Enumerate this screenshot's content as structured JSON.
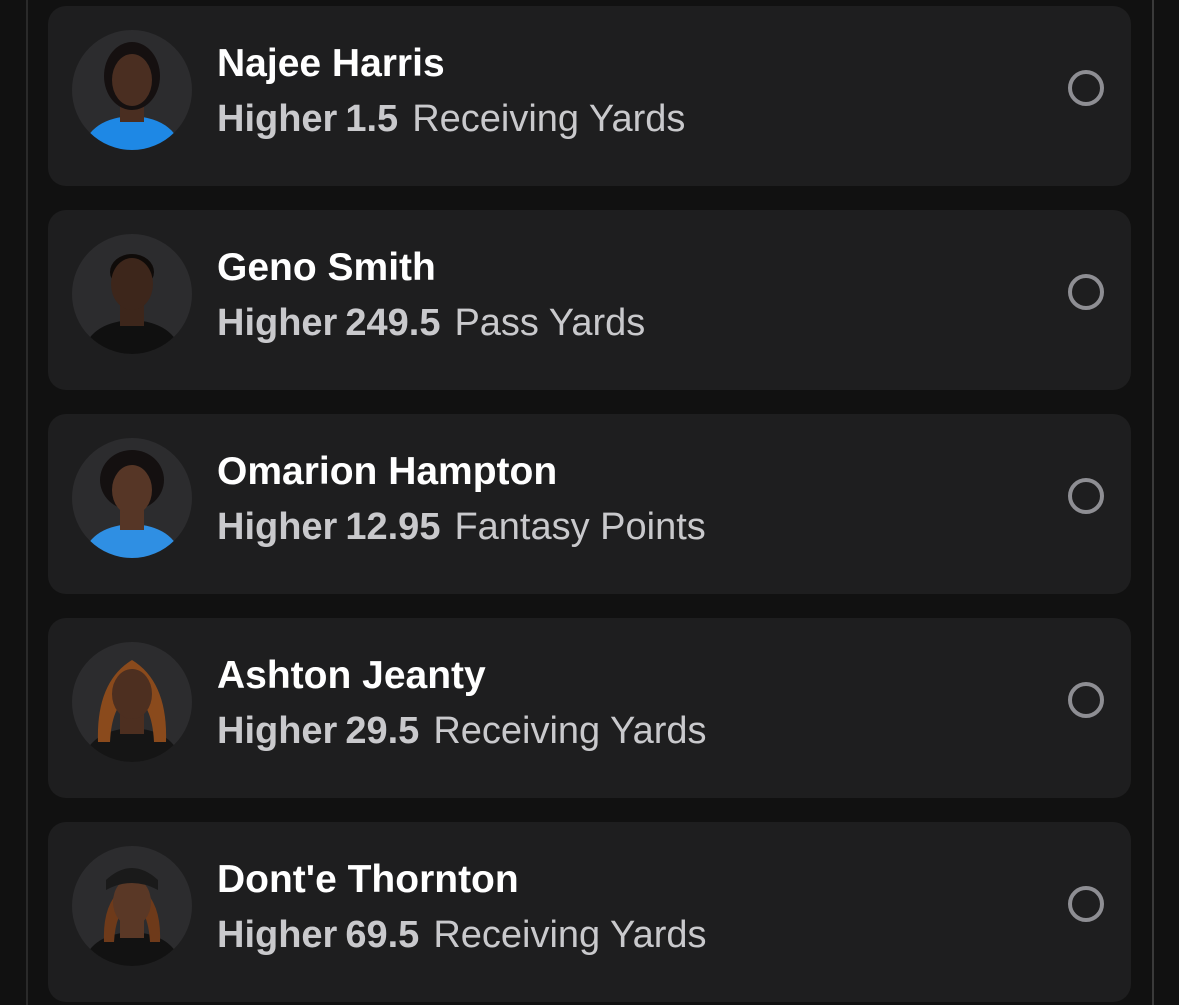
{
  "picks": [
    {
      "player": "Najee Harris",
      "direction": "Higher",
      "line": "1.5",
      "stat": "Receiving Yards",
      "jersey_color": "#1e88e5",
      "skin_color": "#4a2e21",
      "hair_color": "#151010"
    },
    {
      "player": "Geno Smith",
      "direction": "Higher",
      "line": "249.5",
      "stat": "Pass Yards",
      "jersey_color": "#101010",
      "skin_color": "#3d261b",
      "hair_color": "#0f0b09"
    },
    {
      "player": "Omarion Hampton",
      "direction": "Higher",
      "line": "12.95",
      "stat": "Fantasy Points",
      "jersey_color": "#2f8fe3",
      "skin_color": "#563626",
      "hair_color": "#141010"
    },
    {
      "player": "Ashton Jeanty",
      "direction": "Higher",
      "line": "29.5",
      "stat": "Receiving Yards",
      "jersey_color": "#151515",
      "skin_color": "#4d2f20",
      "hair_color": "#8a4a1c"
    },
    {
      "player": "Dont'e Thornton",
      "direction": "Higher",
      "line": "69.5",
      "stat": "Receiving Yards",
      "jersey_color": "#121212",
      "skin_color": "#5a3826",
      "hair_color": "#6e3a1a"
    }
  ],
  "colors": {
    "background": "#111111",
    "card": "#1e1e1f",
    "name_text": "#ffffff",
    "line_text": "#c9c9cc",
    "radio_border": "#8e8e93"
  },
  "icons": {
    "avatar": "player-headshot",
    "selector": "radio-circle-empty"
  }
}
